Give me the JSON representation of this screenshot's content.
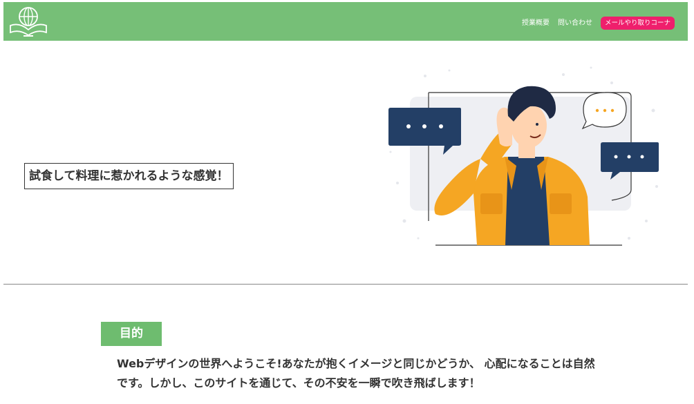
{
  "header": {
    "logo_icon": "globe-book-logo-icon",
    "nav": [
      {
        "label": "授業概要"
      },
      {
        "label": "問い合わせ"
      }
    ],
    "cta_label": "メールやり取りコーナ",
    "colors": {
      "header_bg": "#76bf77",
      "cta_bg": "#ef1f6c"
    }
  },
  "hero": {
    "caption": "試食して料理に惹かれるような感覚！",
    "illustration_icon": "man-listening-speech-bubbles-illustration"
  },
  "section": {
    "title": "目的",
    "body": "Webデザインの世界へようこそ!あなたが抱くイメージと同じかどうか、 心配になることは自然です。しかし、このサイトを通じて、その不安を一瞬で吹き飛ばします！",
    "title_bg": "#6ebc6f"
  }
}
